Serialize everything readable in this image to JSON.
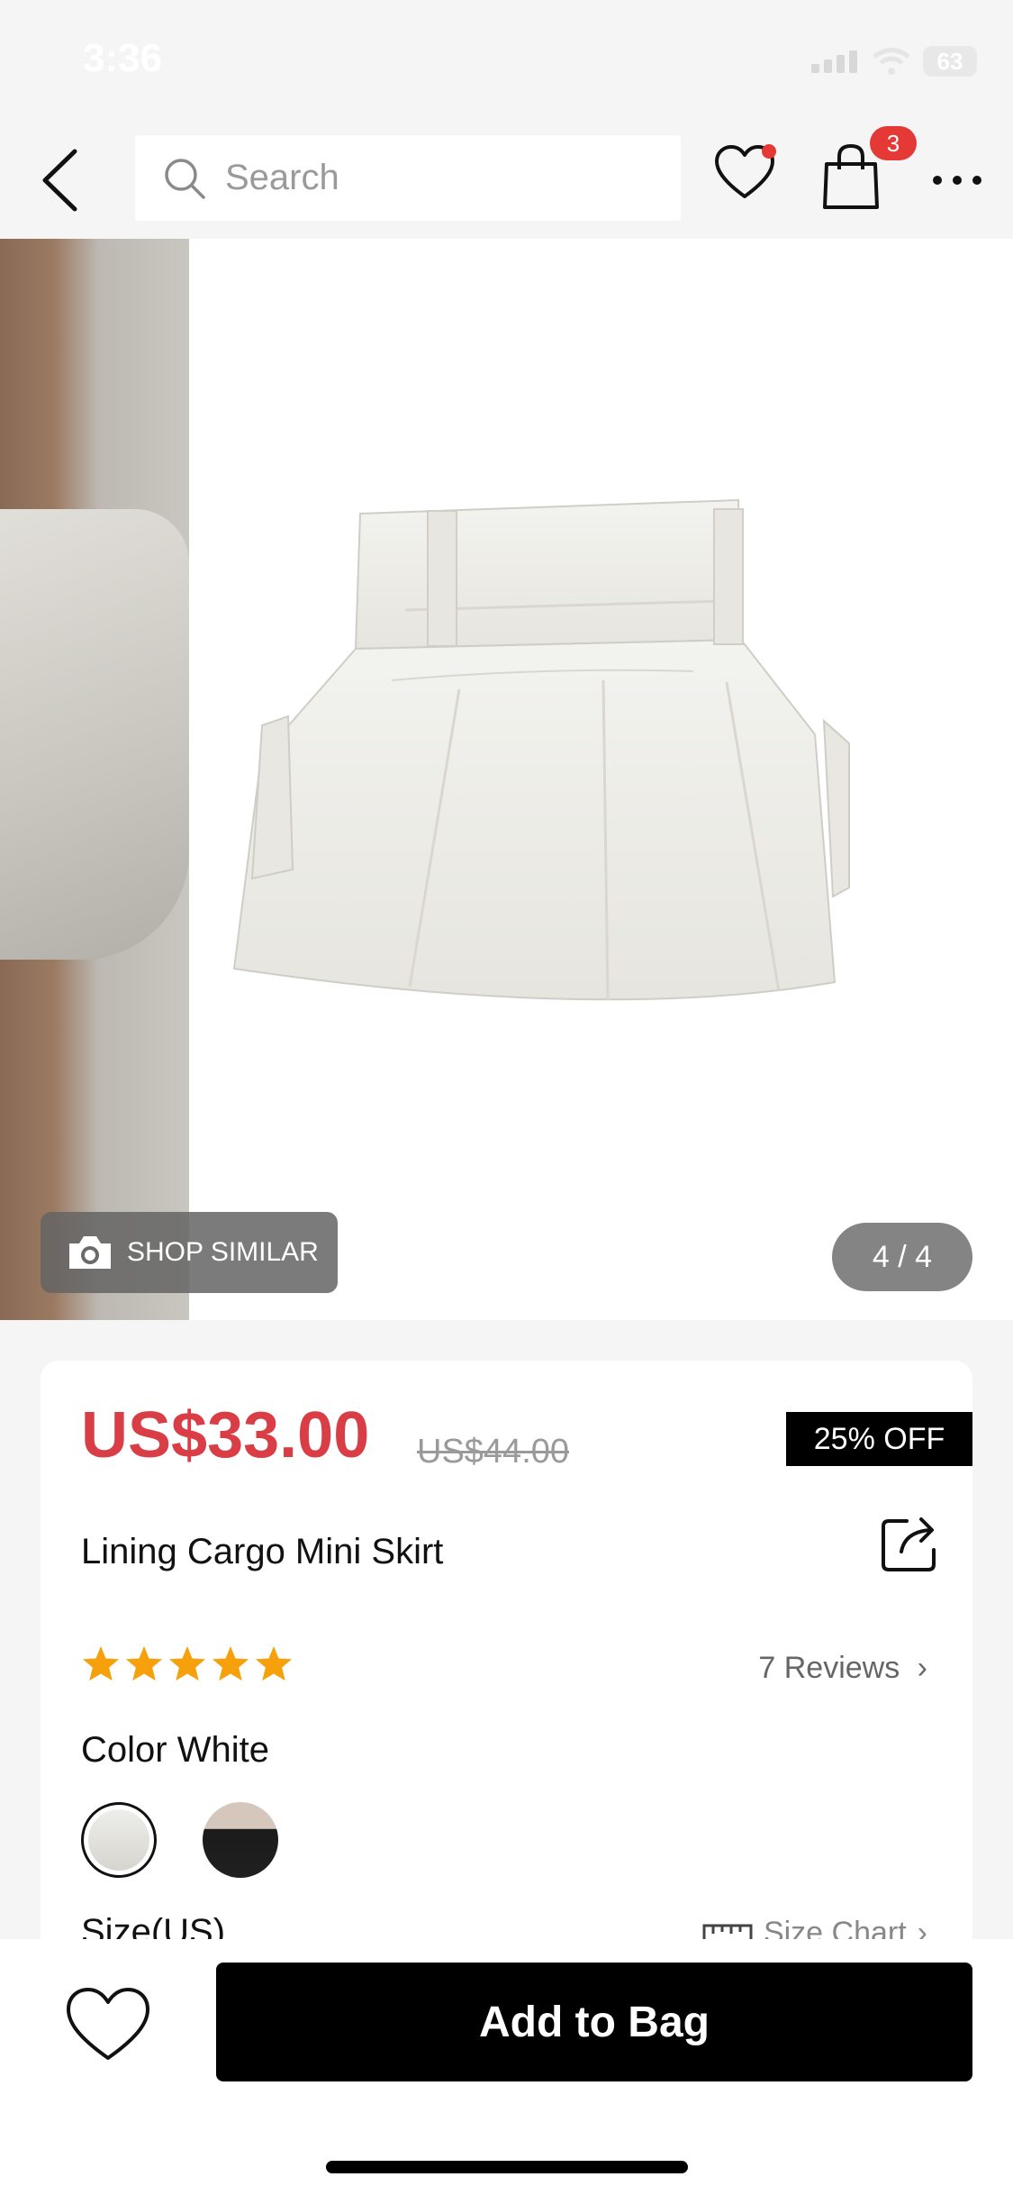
{
  "status_bar": {
    "time": "3:36",
    "battery": "63"
  },
  "nav": {
    "search_placeholder": "Search",
    "cart_count": "3"
  },
  "gallery": {
    "shop_similar_label": "SHOP SIMILAR",
    "counter": "4 / 4"
  },
  "product": {
    "price": "US$33.00",
    "original_price": "US$44.00",
    "discount": "25% OFF",
    "title": "Lining Cargo Mini Skirt",
    "rating": 5,
    "reviews": "7 Reviews",
    "color_label": "Color White",
    "colors": [
      "White",
      "Black"
    ],
    "size_label": "Size(US)",
    "size_chart_label": "Size Chart"
  },
  "bottom_bar": {
    "add_to_bag": "Add to Bag"
  },
  "colors": {
    "accent": "#d93d45",
    "badge": "#e53935",
    "star": "#f6a00c"
  }
}
